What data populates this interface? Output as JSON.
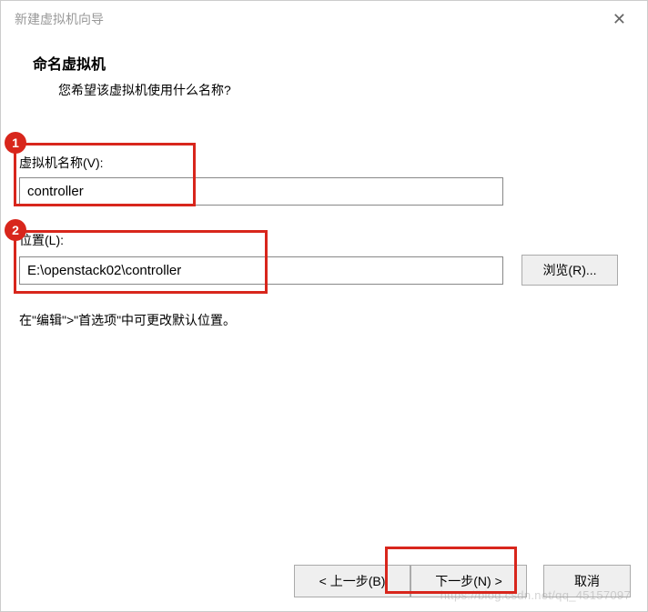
{
  "titlebar": {
    "title": "新建虚拟机向导"
  },
  "header": {
    "title": "命名虚拟机",
    "subtitle": "您希望该虚拟机使用什么名称?"
  },
  "fields": {
    "name_label": "虚拟机名称(V):",
    "name_value": "controller",
    "location_label": "位置(L):",
    "location_value": "E:\\openstack02\\controller",
    "browse_label": "浏览(R)...",
    "hint": "在\"编辑\">\"首选项\"中可更改默认位置。"
  },
  "buttons": {
    "back": "< 上一步(B)",
    "next": "下一步(N) >",
    "cancel": "取消"
  },
  "annotations": {
    "badge1": "1",
    "badge2": "2"
  },
  "watermark": "https://blog.csdn.net/qq_45157097"
}
